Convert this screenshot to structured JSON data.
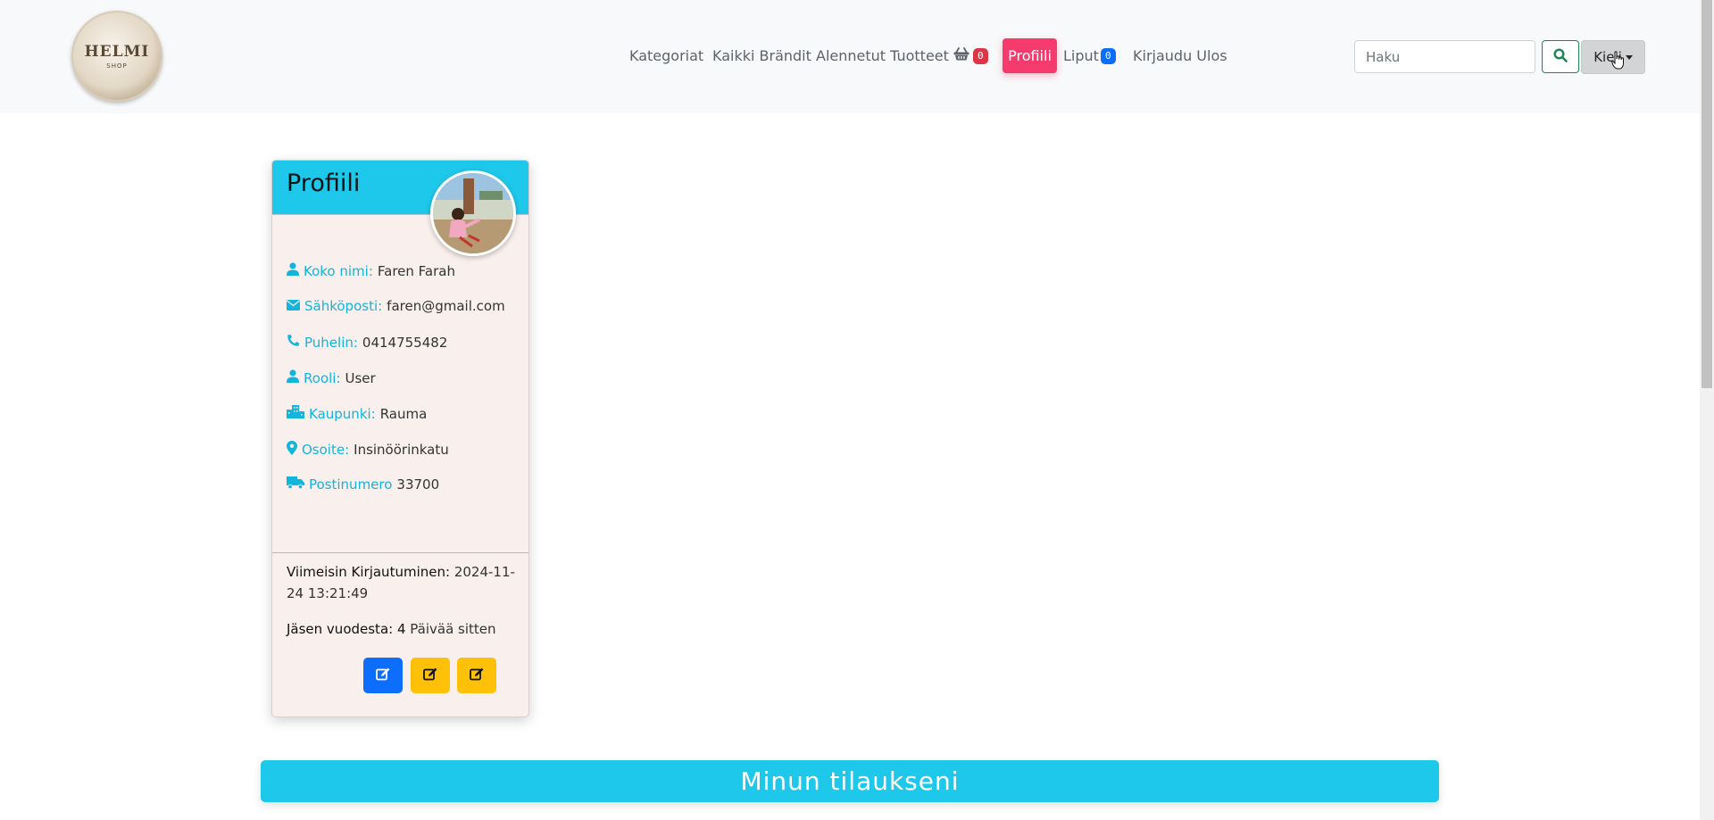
{
  "navbar": {
    "logo": {
      "title": "HELMI",
      "subtitle": "SHOP"
    },
    "links": {
      "categories": "Kategoriat",
      "brands": "Kaikki Brändit",
      "discounted": "Alennetut Tuotteet",
      "cart_count": "0",
      "profile": "Profiili",
      "tickets": "Liput",
      "tickets_count": "0",
      "logout": "Kirjaudu Ulos"
    },
    "search": {
      "placeholder": "Haku",
      "icon": "search-icon"
    },
    "language_button": "Kieli"
  },
  "profile_card": {
    "title": "Profiili",
    "fields": [
      {
        "icon": "user-icon",
        "label": "Koko nimi:",
        "value": "Faren Farah"
      },
      {
        "icon": "envelope-icon",
        "label": "Sähköposti:",
        "value": "faren@gmail.com"
      },
      {
        "icon": "phone-icon",
        "label": "Puhelin:",
        "value": "0414755482"
      },
      {
        "icon": "user-icon",
        "label": "Rooli:",
        "value": "User"
      },
      {
        "icon": "city-icon",
        "label": "Kaupunki:",
        "value": "Rauma"
      },
      {
        "icon": "map-marker-icon",
        "label": "Osoite:",
        "value": "Insinöörinkatu"
      },
      {
        "icon": "truck-icon",
        "label": "Postinumero",
        "value": "33700"
      }
    ],
    "last_login_label": "Viimeisin Kirjautuminen:",
    "last_login_value": "2024-11-24 13:21:49",
    "member_since_label": "Jäsen vuodesta:",
    "member_since_days": "4",
    "member_since_suffix": "Päivää sitten",
    "buttons": [
      {
        "icon": "edit-icon",
        "color": "#0d6efd"
      },
      {
        "icon": "edit-icon",
        "color": "#ffc107"
      },
      {
        "icon": "edit-icon",
        "color": "#ffc107"
      }
    ]
  },
  "orders_section": {
    "title": "Minun tilaukseni"
  },
  "colors": {
    "accent": "#1ec8ea",
    "profile_active": "#f53b6e",
    "cart_badge": "#dc3545",
    "tickets_badge": "#0d6efd"
  }
}
